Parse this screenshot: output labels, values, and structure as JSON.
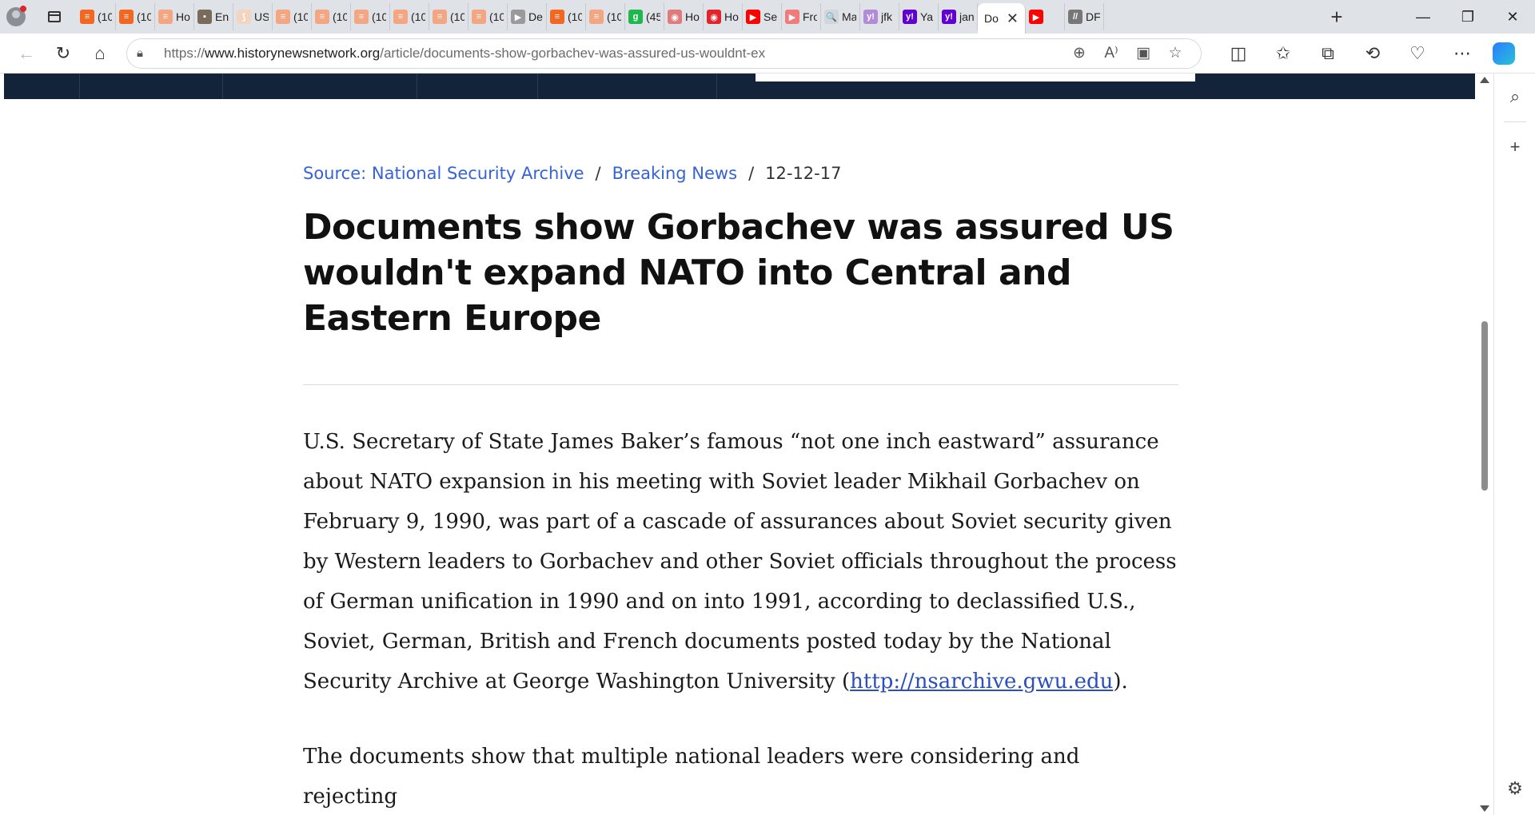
{
  "browser": {
    "tabs": [
      {
        "label": "(10",
        "color": "#f26722",
        "glyph": "≡"
      },
      {
        "label": "(10",
        "color": "#f26722",
        "glyph": "≡"
      },
      {
        "label": "Ho",
        "color": "#f4a582",
        "glyph": "≡"
      },
      {
        "label": "En",
        "color": "#7a6a5a",
        "glyph": "▪"
      },
      {
        "label": "US",
        "color": "#f2d4c0",
        "glyph": "⟆"
      },
      {
        "label": "(10",
        "color": "#f4a582",
        "glyph": "≡"
      },
      {
        "label": "(10",
        "color": "#f4a582",
        "glyph": "≡"
      },
      {
        "label": "(10",
        "color": "#f4a582",
        "glyph": "≡"
      },
      {
        "label": "(10",
        "color": "#f4a582",
        "glyph": "≡"
      },
      {
        "label": "(10",
        "color": "#f4a582",
        "glyph": "≡"
      },
      {
        "label": "(10",
        "color": "#f4a582",
        "glyph": "≡"
      },
      {
        "label": "De",
        "color": "#9a9a9a",
        "glyph": "▶"
      },
      {
        "label": "(10",
        "color": "#f26722",
        "glyph": "≡"
      },
      {
        "label": "(10",
        "color": "#f4a582",
        "glyph": "≡"
      },
      {
        "label": "(45",
        "color": "#1fb84f",
        "glyph": "g"
      },
      {
        "label": "Ho",
        "color": "#e07b7b",
        "glyph": "◉"
      },
      {
        "label": "Ho",
        "color": "#e0262c",
        "glyph": "◉"
      },
      {
        "label": "Se",
        "color": "#ff0000",
        "glyph": "▶"
      },
      {
        "label": "Fro",
        "color": "#f07b7b",
        "glyph": "▶"
      },
      {
        "label": "Ma",
        "color": "#cfd6de",
        "glyph": "🔍"
      },
      {
        "label": "jfk",
        "color": "#b18bd6",
        "glyph": "y!"
      },
      {
        "label": "Ya",
        "color": "#6001d2",
        "glyph": "y!"
      },
      {
        "label": "jan",
        "color": "#6001d2",
        "glyph": "y!"
      }
    ],
    "active_tab": {
      "label": "Do",
      "close": "✕"
    },
    "tabs_after": [
      {
        "label": "",
        "color": "#ff0000",
        "glyph": "▶"
      },
      {
        "label": "DF",
        "color": "#777777",
        "glyph": "//"
      }
    ],
    "new_tab": "+",
    "window": {
      "minimize": "—",
      "restore": "❐",
      "close": "✕"
    },
    "url": {
      "scheme": "https://",
      "host": "www.historynewsnetwork.org",
      "path": "/article/documents-show-gorbachev-was-assured-us-wouldnt-ex"
    },
    "profile_alert_color": "#e0262c",
    "accent": "#3563d6"
  },
  "article": {
    "crumbs": {
      "source": "Source: National Security Archive",
      "category": "Breaking News",
      "separator": "/",
      "date": "12-12-17"
    },
    "title": "Documents show Gorbachev was assured US wouldn't expand NATO into Central and Eastern Europe",
    "p1_text": " U.S. Secretary of State James Baker’s famous “not one inch eastward” assurance about NATO expansion in his meeting with Soviet leader Mikhail Gorbachev on February 9, 1990, was part of a cascade of assurances about Soviet security given by Western leaders to Gorbachev and other Soviet officials throughout the process of German unification in 1990 and on into 1991, according to declassified U.S., Soviet, German, British and French documents posted today by the National Security Archive at George Washington University (",
    "p1_link": "http://nsarchive.gwu.edu",
    "p1_end": ").",
    "p2_text": "The documents show that multiple national leaders were considering and rejecting"
  }
}
